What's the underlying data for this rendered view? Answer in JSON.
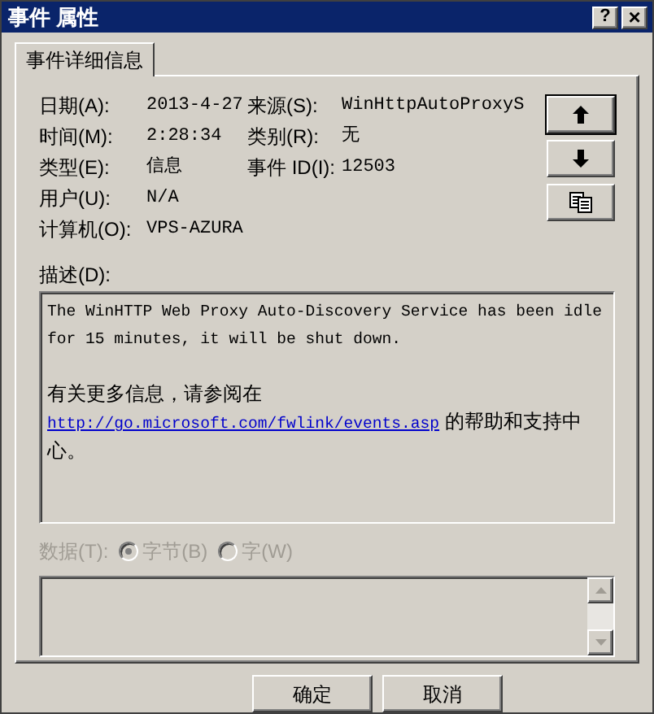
{
  "window": {
    "title": "事件 属性",
    "help": "?",
    "close": "×"
  },
  "tabs": [
    {
      "label": "事件详细信息",
      "selected": true
    }
  ],
  "fields": [
    {
      "label": "日期(A):",
      "value": "2013-4-27"
    },
    {
      "label": "来源(S):",
      "value": "WinHttpAutoProxyS"
    },
    {
      "label": "时间(M):",
      "value": "2:28:34"
    },
    {
      "label": "类别(R):",
      "value": "无"
    },
    {
      "label": "类型(E):",
      "value": "信息"
    },
    {
      "label": "事件 ID(I):",
      "value": "12503"
    },
    {
      "label": "用户(U):",
      "value": "N/A"
    },
    {
      "label": "计算机(O):",
      "value": "VPS-AZURA"
    }
  ],
  "description": {
    "label": "描述(D):",
    "paragraphs": [
      "The WinHTTP Web Proxy Auto-Discovery Service has been idle for 15 minutes, it will be shut down."
    ],
    "more_info": "有关更多信息，请参阅在",
    "link": "http://go.microsoft.com/fwlink/events.asp",
    "after_link": "的帮助和支持中心。"
  },
  "data": {
    "label": "数据(T):",
    "disabled": true,
    "options": [
      {
        "label": "字节(B)",
        "selected": true
      },
      {
        "label": "字(W)",
        "selected": false
      }
    ]
  },
  "buttons": [
    {
      "label": "确定"
    },
    {
      "label": "取消"
    }
  ]
}
